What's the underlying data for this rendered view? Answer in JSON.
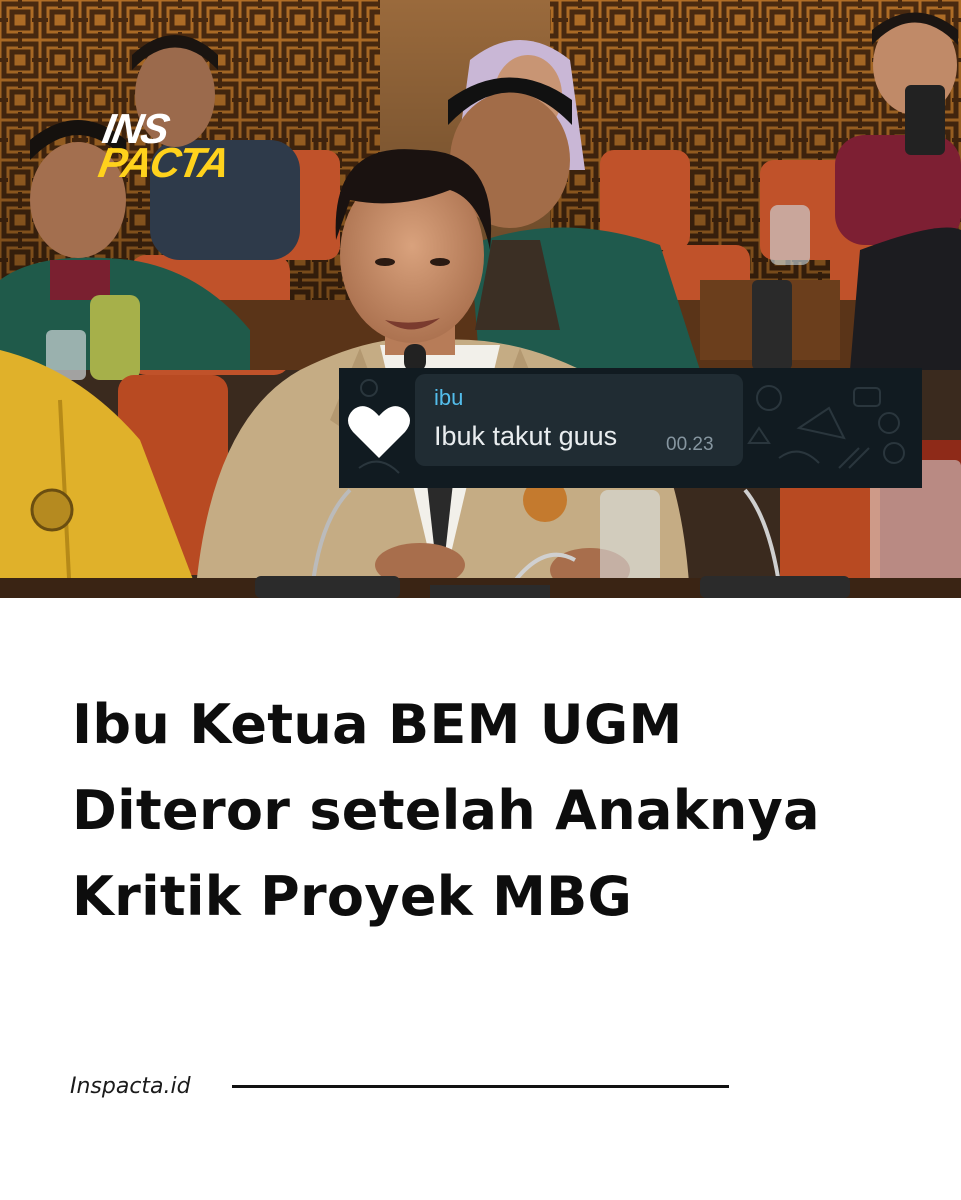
{
  "logo": {
    "line1": "INS",
    "line2": "PACTA",
    "colors": {
      "line1": "#ffffff",
      "line2": "#ffd21c"
    }
  },
  "chat_overlay": {
    "sender": "ibu",
    "message": "Ibuk takut guus",
    "time": "00.23",
    "avatar_icon": "heart-icon",
    "colors": {
      "background": "#111b21",
      "bubble": "#202c33",
      "sender": "#53bdeb",
      "message": "#e9edef"
    }
  },
  "headline": {
    "lines": [
      "Ibu Ketua BEM UGM",
      "Diteror setelah Anaknya",
      "Kritik Proyek MBG"
    ]
  },
  "footer": {
    "source": "Inspacta.id"
  }
}
